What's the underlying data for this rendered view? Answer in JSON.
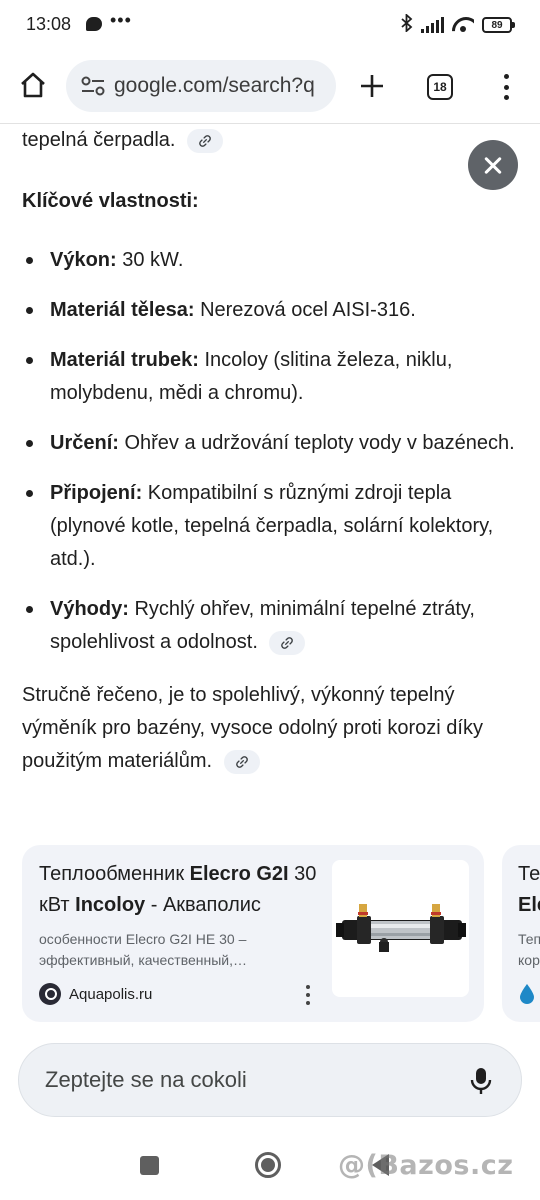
{
  "status_bar": {
    "time": "13:08",
    "more": "•••",
    "battery": "89",
    "icons": [
      "chat-icon",
      "bluetooth-icon",
      "signal-icon",
      "wifi-icon",
      "battery-icon"
    ]
  },
  "browser": {
    "url": "google.com/search?q",
    "tab_count": "18",
    "icons": [
      "home-icon",
      "site-settings-icon",
      "new-tab-icon",
      "tabs-icon",
      "menu-icon"
    ]
  },
  "content": {
    "intro_tail": "tepelná čerpadla.",
    "heading": "Klíčové vlastnosti:",
    "bullets": [
      {
        "label": "Výkon:",
        "text": "30 kW."
      },
      {
        "label": "Materiál tělesa:",
        "text": "Nerezová ocel AISI-316."
      },
      {
        "label": "Materiál trubek:",
        "text": "Incoloy (slitina železa, niklu, molybdenu, mědi a chromu)."
      },
      {
        "label": "Určení:",
        "text": "Ohřev a udržování teploty vody v bazénech."
      },
      {
        "label": "Připojení:",
        "text": "Kompatibilní s různými zdroji tepla (plynové kotle, tepelná čerpadla, solární kolektory, atd.)."
      },
      {
        "label": "Výhody:",
        "text": "Rychlý ohřev, minimální tepelné ztráty, spolehlivost a odolnost."
      }
    ],
    "summary": "Stručně řečeno, je to spolehlivý, výkonný tepelný výměník pro bazény, vysoce odolný proti korozi díky použitým materiálům."
  },
  "card": {
    "title_a": "Теплообменник ",
    "title_b": "Elecro G2I",
    "title_c": " 30 кВт ",
    "title_d": "Incoloy",
    "title_e": " - Акваполис",
    "snippet": "особенности Elecro G2I HE 30 – эффективный, качественный,…",
    "source": "Aquapolis.ru"
  },
  "card2": {
    "title_line1": "Теп",
    "title_line2": "Ele",
    "snippet_line1": "Теп",
    "snippet_line2": "кор"
  },
  "ask": {
    "placeholder": "Zeptejte se na cokoli"
  },
  "watermark": "@(Bazos.cz",
  "colors": {
    "close_button": "#5f6368",
    "card_bg": "#f1f3f8",
    "ask_bar_bg": "#eef1f5"
  }
}
